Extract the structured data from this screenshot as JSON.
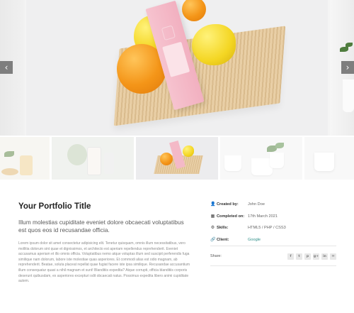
{
  "slider": {
    "prev_arrow": "‹",
    "next_arrow": "›",
    "product_label": "Kirana"
  },
  "thumbnails": [
    {
      "name": "plants-and-jars"
    },
    {
      "name": "cosmetics-flatlay"
    },
    {
      "name": "pink-box-oranges",
      "active": true
    },
    {
      "name": "white-cups-plant"
    },
    {
      "name": "white-mug"
    }
  ],
  "portfolio": {
    "title": "Your Portfolio Title",
    "lead": "Illum molestias cupiditate eveniet dolore obcaecati voluptatibus est quos eos id recusandae officia.",
    "body": "Lorem ipsum dolor sit amet consectetur adipisicing elit. Tenetur quisquam, omnis illum necessitatibus, vero mollitia dolorum sint quae et dignissimos, et architecto est aperiam repellendus reprehenderit. Eveniet accusamus aperiam et illo omnis officia. Voluptatibus nemo atque voluptas illum sed suscipit perferendis fuga similique nam dolorum, labore iste molestiae quas asperiores. Et commodi alias est odio magnam, ab reprehenderit. Beatae, soluta placeat repellat quae fugiat facere iste ipsa similique. Recusandae accusantium illum consequatur quasi a nihil magnam et sunt! Blanditiis expedita? Atque corrupti, officia blanditiis corporis deserunt quibusdam, ex asperiores excepturi odit obcaecati natus. Possimus expedita libero animi cupiditate autem."
  },
  "meta": [
    {
      "icon": "user-icon",
      "glyph": "👤",
      "label": "Created by:",
      "value": "John Doe",
      "is_link": false
    },
    {
      "icon": "calendar-icon",
      "glyph": "▦",
      "label": "Completed on:",
      "value": "17th March 2021",
      "is_link": false
    },
    {
      "icon": "gear-icon",
      "glyph": "⚙",
      "label": "Skills:",
      "value": "HTML5 / PHP / CSS3",
      "is_link": false
    },
    {
      "icon": "link-icon",
      "glyph": "🔗",
      "label": "Client:",
      "value": "Google",
      "is_link": true
    }
  ],
  "share": {
    "label": "Share:",
    "buttons": [
      {
        "icon": "facebook-icon",
        "glyph": "f"
      },
      {
        "icon": "twitter-icon",
        "glyph": "t"
      },
      {
        "icon": "pinterest-icon",
        "glyph": "p"
      },
      {
        "icon": "google-plus-icon",
        "glyph": "g+"
      },
      {
        "icon": "linkedin-icon",
        "glyph": "in"
      },
      {
        "icon": "email-icon",
        "glyph": "✉"
      }
    ]
  },
  "colors": {
    "link": "#2f8f89",
    "product_box": "#f2b0c0",
    "arrow_bg": "#7e7e7e"
  }
}
